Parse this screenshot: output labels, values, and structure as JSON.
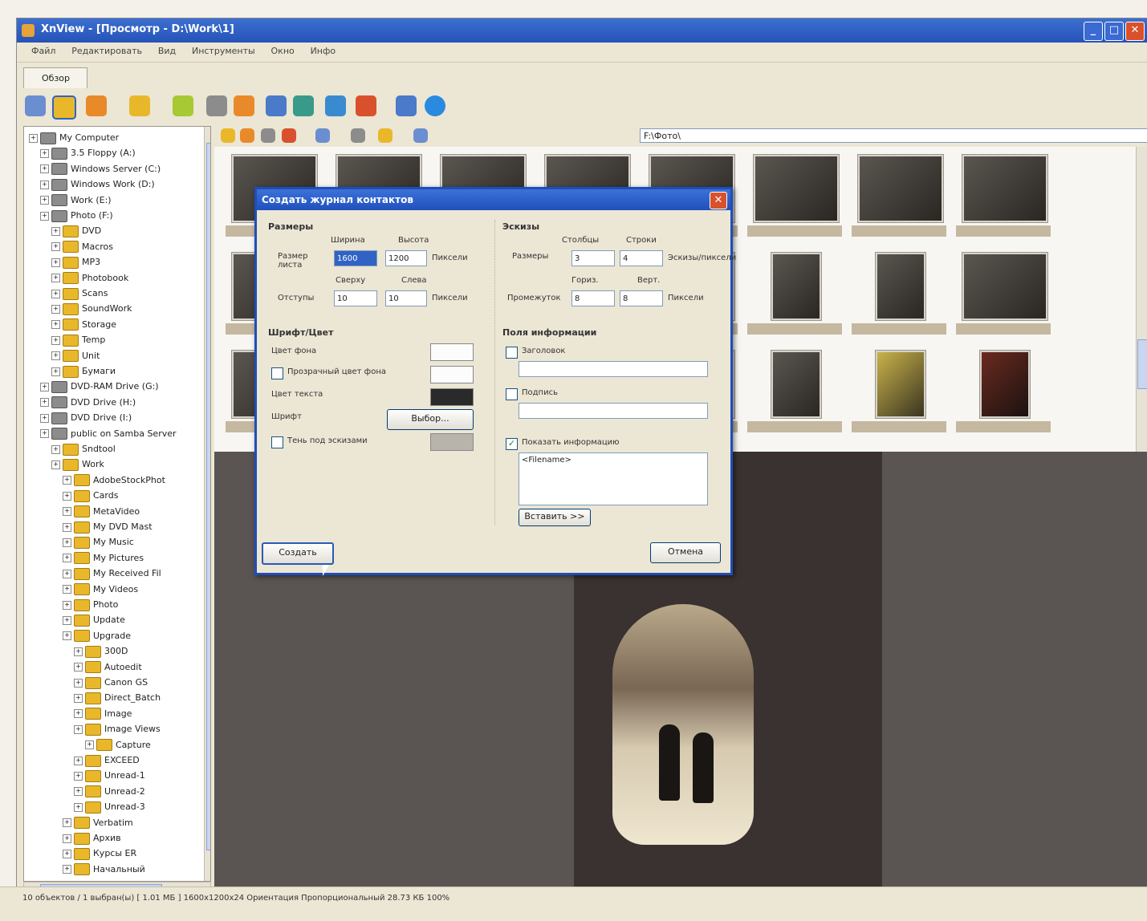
{
  "window": {
    "title": "XnView - [Просмотр - D:\\Work\\1]",
    "controls": {
      "minimize": "_",
      "maximize": "□",
      "close": "✕"
    }
  },
  "menu": [
    "Файл",
    "Редактировать",
    "Вид",
    "Инструменты",
    "Окно",
    "Инфо"
  ],
  "tab": {
    "label": "Обзор"
  },
  "toolbar_icons": [
    "view-icon",
    "browser-icon",
    "up-icon",
    "folder-icon",
    "refresh-icon",
    "print-icon",
    "export-icon",
    "capture-icon",
    "slideshow-icon",
    "rotate-icon",
    "settings-icon",
    "info-icon",
    "help-icon"
  ],
  "tree": {
    "items": [
      {
        "label": "My Computer",
        "indent": 0,
        "kind": "drive"
      },
      {
        "label": "3.5 Floppy (A:)",
        "indent": 1,
        "kind": "drive"
      },
      {
        "label": "Windows Server (C:)",
        "indent": 1,
        "kind": "drive"
      },
      {
        "label": "Windows Work (D:)",
        "indent": 1,
        "kind": "drive"
      },
      {
        "label": "Work (E:)",
        "indent": 1,
        "kind": "drive"
      },
      {
        "label": "Photo (F:)",
        "indent": 1,
        "kind": "drive"
      },
      {
        "label": "DVD",
        "indent": 2,
        "kind": "folder"
      },
      {
        "label": "Macros",
        "indent": 2,
        "kind": "folder"
      },
      {
        "label": "MP3",
        "indent": 2,
        "kind": "folder"
      },
      {
        "label": "Photobook",
        "indent": 2,
        "kind": "folder"
      },
      {
        "label": "Scans",
        "indent": 2,
        "kind": "folder"
      },
      {
        "label": "SoundWork",
        "indent": 2,
        "kind": "folder"
      },
      {
        "label": "Storage",
        "indent": 2,
        "kind": "folder"
      },
      {
        "label": "Temp",
        "indent": 2,
        "kind": "folder"
      },
      {
        "label": "Unit",
        "indent": 2,
        "kind": "folder"
      },
      {
        "label": "Бумаги",
        "indent": 2,
        "kind": "folder"
      },
      {
        "label": "DVD-RAM Drive (G:)",
        "indent": 1,
        "kind": "drive"
      },
      {
        "label": "DVD Drive (H:)",
        "indent": 1,
        "kind": "drive"
      },
      {
        "label": "DVD Drive (I:)",
        "indent": 1,
        "kind": "drive"
      },
      {
        "label": "public on Samba Server",
        "indent": 1,
        "kind": "drive"
      },
      {
        "label": "Sndtool",
        "indent": 2,
        "kind": "folder"
      },
      {
        "label": "Work",
        "indent": 2,
        "kind": "folder"
      },
      {
        "label": "AdobeStockPhot",
        "indent": 3,
        "kind": "folder"
      },
      {
        "label": "Cards",
        "indent": 3,
        "kind": "folder"
      },
      {
        "label": "MetaVideo",
        "indent": 3,
        "kind": "folder"
      },
      {
        "label": "My DVD Mast",
        "indent": 3,
        "kind": "folder"
      },
      {
        "label": "My Music",
        "indent": 3,
        "kind": "folder"
      },
      {
        "label": "My Pictures",
        "indent": 3,
        "kind": "folder"
      },
      {
        "label": "My Received Fil",
        "indent": 3,
        "kind": "folder"
      },
      {
        "label": "My Videos",
        "indent": 3,
        "kind": "folder"
      },
      {
        "label": "Photo",
        "indent": 3,
        "kind": "folder"
      },
      {
        "label": "Update",
        "indent": 3,
        "kind": "folder"
      },
      {
        "label": "Upgrade",
        "indent": 3,
        "kind": "folder"
      },
      {
        "label": "300D",
        "indent": 4,
        "kind": "folder"
      },
      {
        "label": "Autoedit",
        "indent": 4,
        "kind": "folder"
      },
      {
        "label": "Canon GS",
        "indent": 4,
        "kind": "folder"
      },
      {
        "label": "Direct_Batch",
        "indent": 4,
        "kind": "folder"
      },
      {
        "label": "Image",
        "indent": 4,
        "kind": "folder"
      },
      {
        "label": "Image Views",
        "indent": 4,
        "kind": "folder"
      },
      {
        "label": "Capture",
        "indent": 5,
        "kind": "folder"
      },
      {
        "label": "EXCEED",
        "indent": 4,
        "kind": "folder"
      },
      {
        "label": "Unread-1",
        "indent": 4,
        "kind": "folder"
      },
      {
        "label": "Unread-2",
        "indent": 4,
        "kind": "folder"
      },
      {
        "label": "Unread-3",
        "indent": 4,
        "kind": "folder"
      },
      {
        "label": "Verbatim",
        "indent": 3,
        "kind": "folder"
      },
      {
        "label": "Архив",
        "indent": 3,
        "kind": "folder"
      },
      {
        "label": "Курсы ER",
        "indent": 3,
        "kind": "folder"
      },
      {
        "label": "Начальный",
        "indent": 3,
        "kind": "folder"
      }
    ]
  },
  "path": "F:\\Фото\\",
  "dialog": {
    "title": "Создать журнал контактов",
    "close": "✕",
    "sizes": {
      "group": "Размеры",
      "width_label": "Ширина",
      "height_label": "Высота",
      "page_label": "Размер листа",
      "page_width": "1600",
      "page_height": "1200",
      "page_unit": "Пиксели",
      "margin_top_label": "Сверху",
      "margin_left_label": "Слева",
      "margins_label": "Отступы",
      "margin_top": "10",
      "margin_left": "10",
      "margin_unit": "Пиксели"
    },
    "thumbs": {
      "group": "Эскизы",
      "cols_label": "Столбцы",
      "rows_label": "Строки",
      "count_label": "Размеры",
      "cols": "3",
      "rows": "4",
      "count_unit": "Эскизы/пиксели",
      "hgap_label": "Гориз.",
      "vgap_label": "Верт.",
      "gap_label": "Промежуток",
      "hgap": "8",
      "vgap": "8",
      "gap_unit": "Пиксели"
    },
    "fonts": {
      "group": "Шрифт/Цвет",
      "bg_color_label": "Цвет фона",
      "transparent_label": "Прозрачный цвет фона",
      "text_color_label": "Цвет текста",
      "font_label": "Шрифт",
      "font_button": "Выбор...",
      "shadow_label": "Тень под эскизами"
    },
    "info": {
      "group": "Поля информации",
      "header_label": "Заголовок",
      "footer_label": "Подпись",
      "show_info_label": "Показать информацию",
      "info_text": "<Filename>",
      "insert_button": "Вставить >>"
    },
    "create_button": "Создать",
    "cancel_button": "Отмена"
  },
  "status": {
    "text": "10 объектов / 1 выбран(ы) [ 1.01 МБ ]  1600x1200x24  Ориентация  Пропорциональный  28.73 КБ  100%"
  },
  "colors": {
    "title_blue": "#2553b8",
    "dialog_bg": "#ece6d4",
    "preview_bg": "#5a5453"
  }
}
